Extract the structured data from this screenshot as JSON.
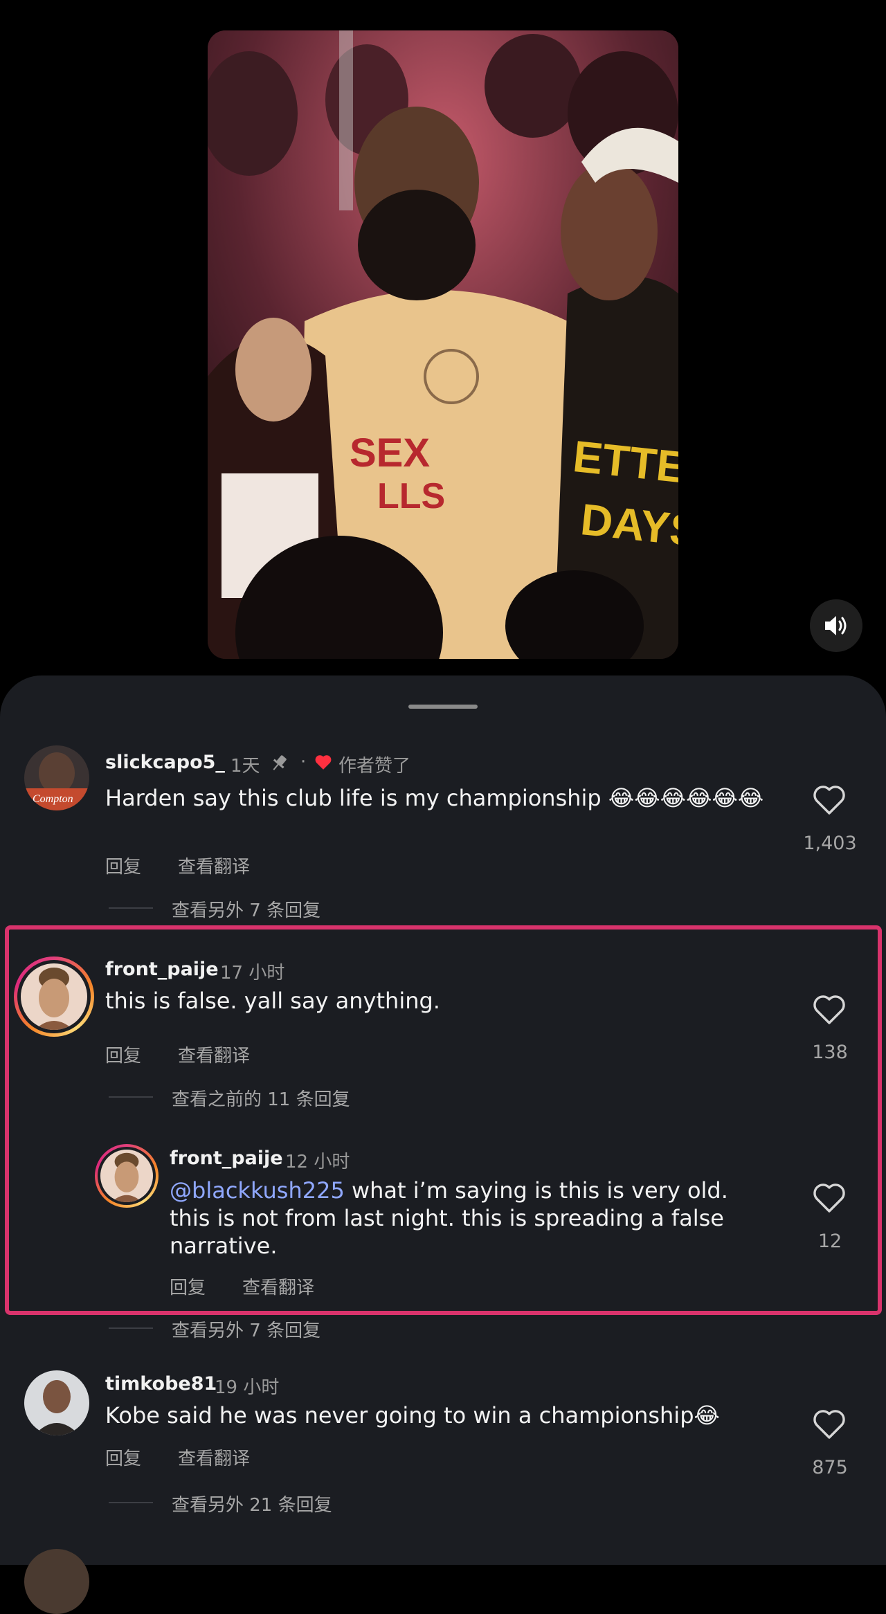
{
  "comments": [
    {
      "username": "slickcapo5_",
      "time": "1天",
      "separator": "·",
      "author_liked": "作者赞了",
      "text": "Harden say this club life is my  championship 😂😂😂😂😂😂",
      "reply": "回复",
      "translate": "查看翻译",
      "view_more": "查看另外 7 条回复",
      "likes": "1,403"
    },
    {
      "username": "front_paije",
      "time": "17 小时",
      "text": "this is false. yall say anything.",
      "reply": "回复",
      "translate": "查看翻译",
      "view_previous": "查看之前的 11 条回复",
      "likes": "138"
    },
    {
      "username": "front_paije",
      "time": "12 小时",
      "mention": "@blackkush225",
      "text": " what i’m saying is this is very old. this is not from last night. this is spreading a false narrative.",
      "reply": "回复",
      "translate": "查看翻译",
      "view_more": "查看另外 7 条回复",
      "likes": "12"
    },
    {
      "username": "timkobe81",
      "time": "19 小时",
      "text": "Kobe said he was never going to win a championship😂",
      "reply": "回复",
      "translate": "查看翻译",
      "view_more": "查看另外 21 条回复",
      "likes": "875"
    }
  ],
  "colors": {
    "highlight": "#d9336c",
    "mention": "#90a8ff",
    "heart_red": "#ff3040"
  },
  "icons": [
    "speaker-icon",
    "pin-icon",
    "heart-icon"
  ]
}
